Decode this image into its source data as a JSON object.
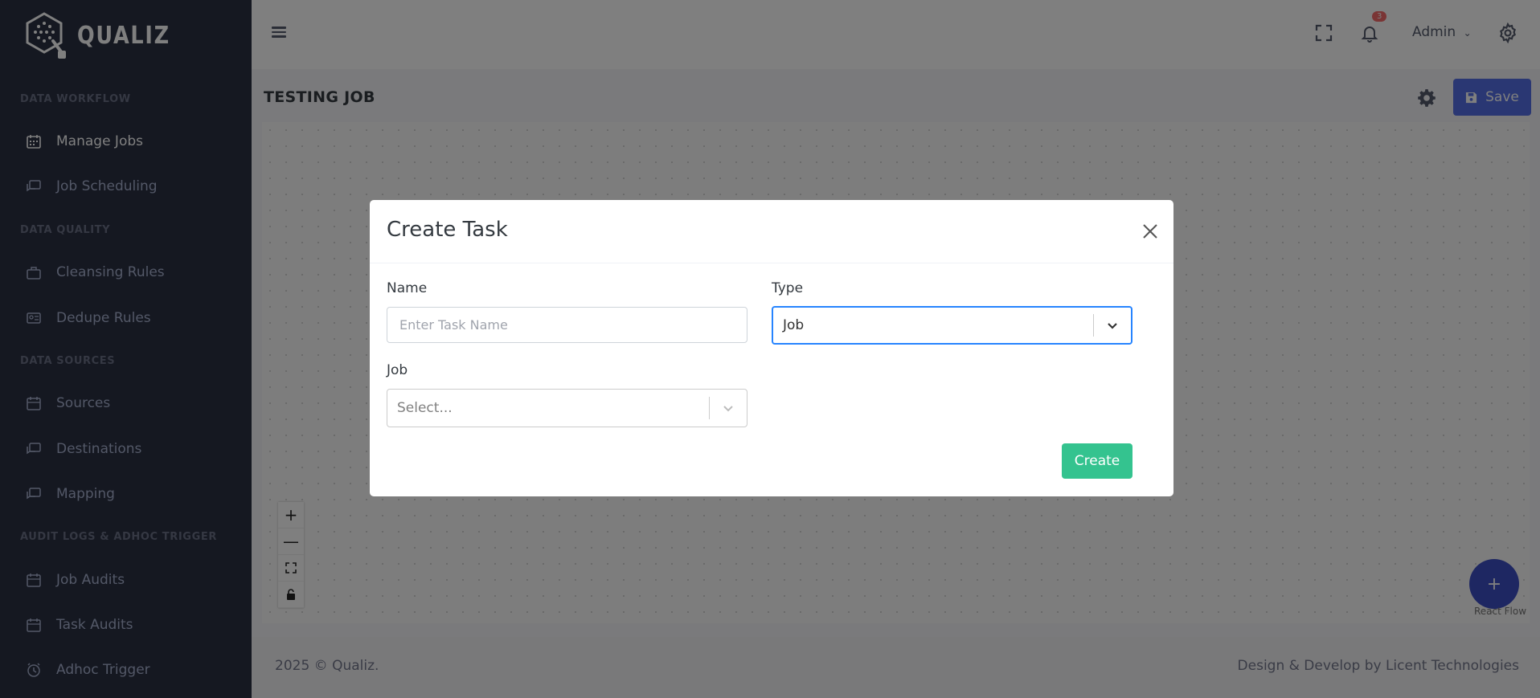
{
  "brand": {
    "name": "QUALIZ"
  },
  "sidebar": {
    "sections": [
      {
        "title": "DATA WORKFLOW",
        "items": [
          {
            "label": "Manage Jobs",
            "icon": "calendar-icon"
          },
          {
            "label": "Job Scheduling",
            "icon": "chat-icon"
          }
        ]
      },
      {
        "title": "DATA QUALITY",
        "items": [
          {
            "label": "Cleansing Rules",
            "icon": "briefcase-icon"
          },
          {
            "label": "Dedupe Rules",
            "icon": "id-card-icon"
          }
        ]
      },
      {
        "title": "DATA SOURCES",
        "items": [
          {
            "label": "Sources",
            "icon": "calendar-icon"
          },
          {
            "label": "Destinations",
            "icon": "chat-icon"
          },
          {
            "label": "Mapping",
            "icon": "chat-icon"
          }
        ]
      },
      {
        "title": "AUDIT LOGS & ADHOC TRIGGER",
        "items": [
          {
            "label": "Job Audits",
            "icon": "calendar-icon"
          },
          {
            "label": "Task Audits",
            "icon": "calendar-icon"
          },
          {
            "label": "Adhoc Trigger",
            "icon": "alarm-icon"
          }
        ]
      }
    ]
  },
  "topbar": {
    "notification_count": "3",
    "user": "Admin"
  },
  "page": {
    "title": "TESTING JOB",
    "save_label": "Save"
  },
  "canvas": {
    "attribution": "React Flow",
    "fab_label": "+"
  },
  "footer": {
    "left": "2025 © Qualiz.",
    "right": "Design & Develop by Licent Technologies"
  },
  "modal": {
    "title": "Create Task",
    "name_label": "Name",
    "name_placeholder": "Enter Task Name",
    "type_label": "Type",
    "type_value": "Job",
    "job_label": "Job",
    "job_placeholder": "Select...",
    "create_label": "Create"
  },
  "colors": {
    "sidebar": "#2a3042",
    "primary": "#556ee6",
    "success": "#34c38f",
    "focus": "#2684ff"
  }
}
